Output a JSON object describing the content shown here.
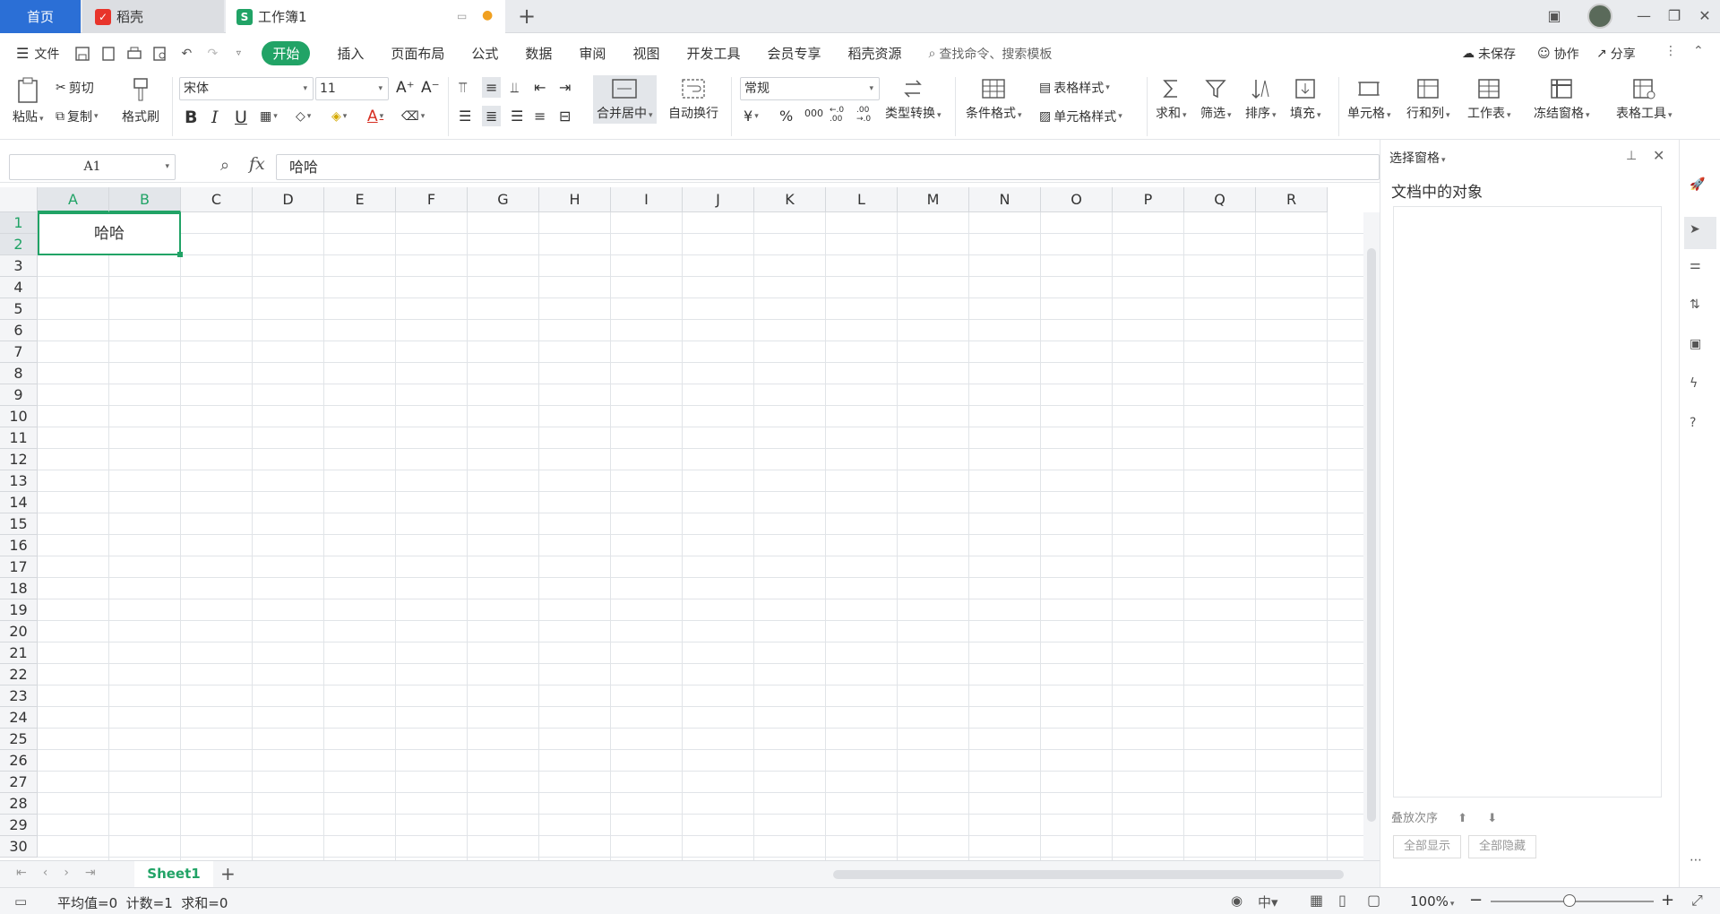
{
  "tabs": {
    "home": "首页",
    "docer": "稻壳",
    "workbook": "工作簿1"
  },
  "menu": {
    "file": "文件",
    "start": "开始",
    "items": [
      "插入",
      "页面布局",
      "公式",
      "数据",
      "审阅",
      "视图",
      "开发工具",
      "会员专享",
      "稻壳资源"
    ],
    "search_placeholder": "查找命令、搜索模板",
    "unsaved": "未保存",
    "collab": "协作",
    "share": "分享"
  },
  "ribbon": {
    "paste": "粘贴",
    "cut": "剪切",
    "copy": "复制",
    "format_painter": "格式刷",
    "font": "宋体",
    "font_size": "11",
    "merge_center": "合并居中",
    "wrap_text": "自动换行",
    "number_format": "常规",
    "type_convert": "类型转换",
    "cond_format": "条件格式",
    "table_style": "表格样式",
    "cell_style": "单元格样式",
    "sum": "求和",
    "filter": "筛选",
    "sort": "排序",
    "fill": "填充",
    "cell": "单元格",
    "row_col": "行和列",
    "worksheet": "工作表",
    "freeze": "冻结窗格",
    "table_tools": "表格工具",
    "bold": "B",
    "italic": "I",
    "underline": "U",
    "currency": "¥",
    "percent": "%",
    "thousands": "000",
    "dec_inc": "←.0 .00",
    "dec_dec": ".00 →.0"
  },
  "formula": {
    "name_box": "A1",
    "fx": "fx",
    "content": "哈哈"
  },
  "grid": {
    "columns": [
      "A",
      "B",
      "C",
      "D",
      "E",
      "F",
      "G",
      "H",
      "I",
      "J",
      "K",
      "L",
      "M",
      "N",
      "O",
      "P",
      "Q",
      "R"
    ],
    "rows": [
      "1",
      "2",
      "3",
      "4",
      "5",
      "6",
      "7",
      "8",
      "9",
      "10",
      "11",
      "12",
      "13",
      "14",
      "15",
      "16",
      "17",
      "18",
      "19",
      "20",
      "21",
      "22",
      "23",
      "24",
      "25",
      "26",
      "27",
      "28",
      "29",
      "30"
    ],
    "merged_cell_value": "哈哈"
  },
  "sheets": {
    "active": "Sheet1"
  },
  "status": {
    "stats": "平均值=0  计数=1  求和=0",
    "zoom": "100%"
  },
  "pane": {
    "title": "选择窗格",
    "heading": "文档中的对象",
    "sort_label": "叠放次序",
    "show_all": "全部显示",
    "hide_all": "全部隐藏"
  },
  "colors": {
    "accent": "#21a366",
    "home_tab": "#2b6fd6"
  }
}
